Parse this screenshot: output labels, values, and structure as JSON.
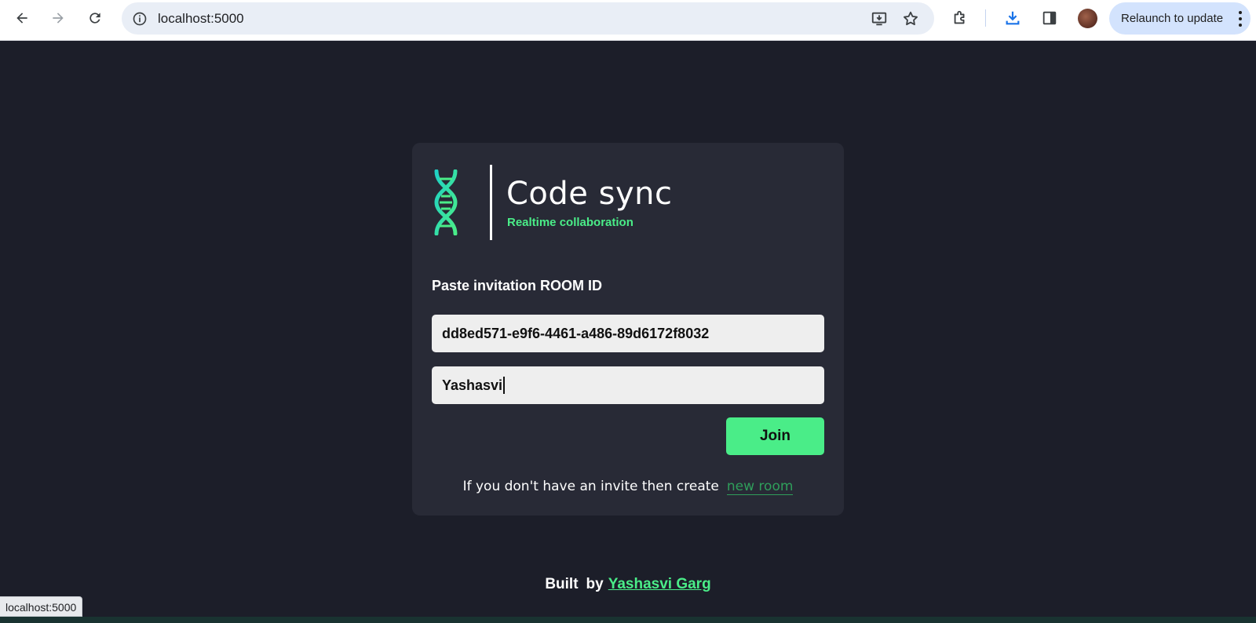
{
  "browser": {
    "url": "localhost:5000",
    "relaunch_label": "Relaunch to update",
    "status_url": "localhost:5000"
  },
  "logo": {
    "title": "Code sync",
    "subtitle": "Realtime collaboration"
  },
  "form": {
    "heading": "Paste invitation ROOM ID",
    "room_id_value": "dd8ed571-e9f6-4461-a486-89d6172f8032",
    "username_value": "Yashasvi",
    "join_label": "Join",
    "create_text": "If you don't have an invite then create",
    "create_link": "new room"
  },
  "footer": {
    "built": "Built",
    "by": "by",
    "author": "Yashasvi Garg"
  },
  "colors": {
    "background": "#1c1e29",
    "card": "#282a36",
    "accent": "#4aed88"
  }
}
